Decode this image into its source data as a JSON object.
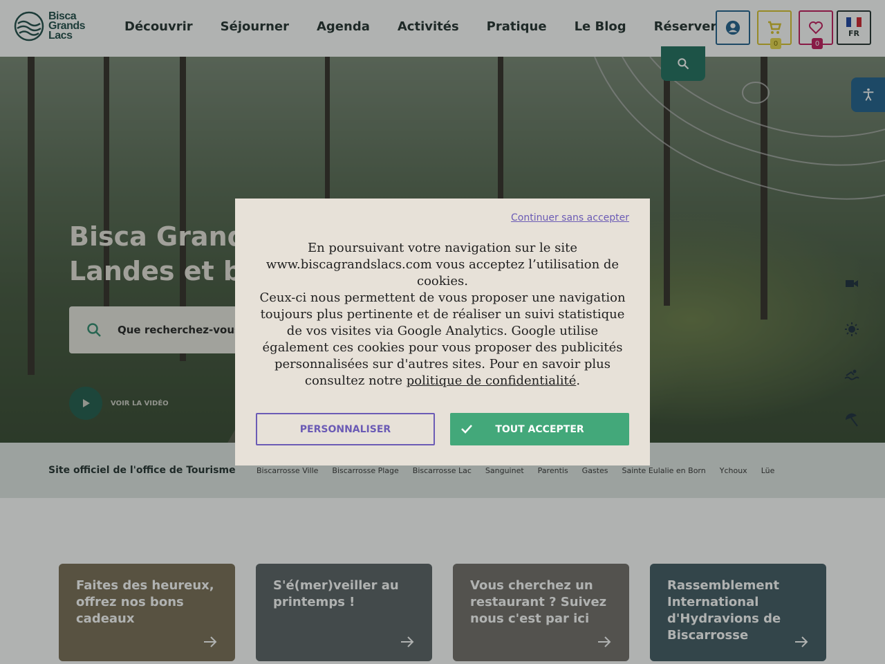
{
  "header": {
    "logo": [
      "Bisca",
      "Grands",
      "Lacs"
    ],
    "nav": [
      "Découvrir",
      "Séjourner",
      "Agenda",
      "Activités",
      "Pratique",
      "Le Blog",
      "Réserver"
    ],
    "cart_count": "0",
    "favorites_count": "0",
    "language": "FR"
  },
  "hero": {
    "title_lines": [
      "Bisca Grand",
      "Landes et bi"
    ],
    "search_placeholder": "Que recherchez-vous",
    "video_label": "VOIR LA VIDÉO"
  },
  "official": {
    "title": "Site officiel de l'office de Tourisme",
    "towns": [
      "Biscarrosse Ville",
      "Biscarrosse Plage",
      "Biscarrosse Lac",
      "Sanguinet",
      "Parentis",
      "Gastes",
      "Sainte Eulalie en Born",
      "Ychoux",
      "Lüe"
    ]
  },
  "cards": [
    {
      "title": "Faites des heureux, offrez nos bons cadeaux",
      "bg": "#9a8a6a"
    },
    {
      "title": "S'é(mer)veiller au printemps !",
      "bg": "#6f7a7e"
    },
    {
      "title": "Vous cherchez un restaurant ? Suivez nous c'est par ici",
      "bg": "#8f8a84"
    },
    {
      "title": "Rassemblement International d'Hydravions de Biscarrosse",
      "bg": "#4e6f7c"
    }
  ],
  "cookie": {
    "continue_label": "Continuer sans accepter",
    "text_part1": "En poursuivant votre navigation sur le site www.biscagrandslacs.com vous acceptez l’utilisation de cookies.",
    "text_part2": "Ceux-ci nous permettent de vous proposer une navigation toujours plus pertinente et de réaliser un suivi statistique de vos visites via Google Analytics. Google utilise également ces cookies pour vous proposer des publicités personnalisées sur d'autres sites. Pour en savoir plus consultez notre",
    "policy_link": "politique de confidentialité",
    "text_end": ".",
    "customize_label": "PERSONNALISER",
    "accept_label": "TOUT ACCEPTER"
  },
  "colors": {
    "brand_dark": "#1e4a47",
    "accent_green": "#43a87a",
    "accent_purple": "#6b5bb5",
    "account_blue": "#1e5e8c"
  }
}
